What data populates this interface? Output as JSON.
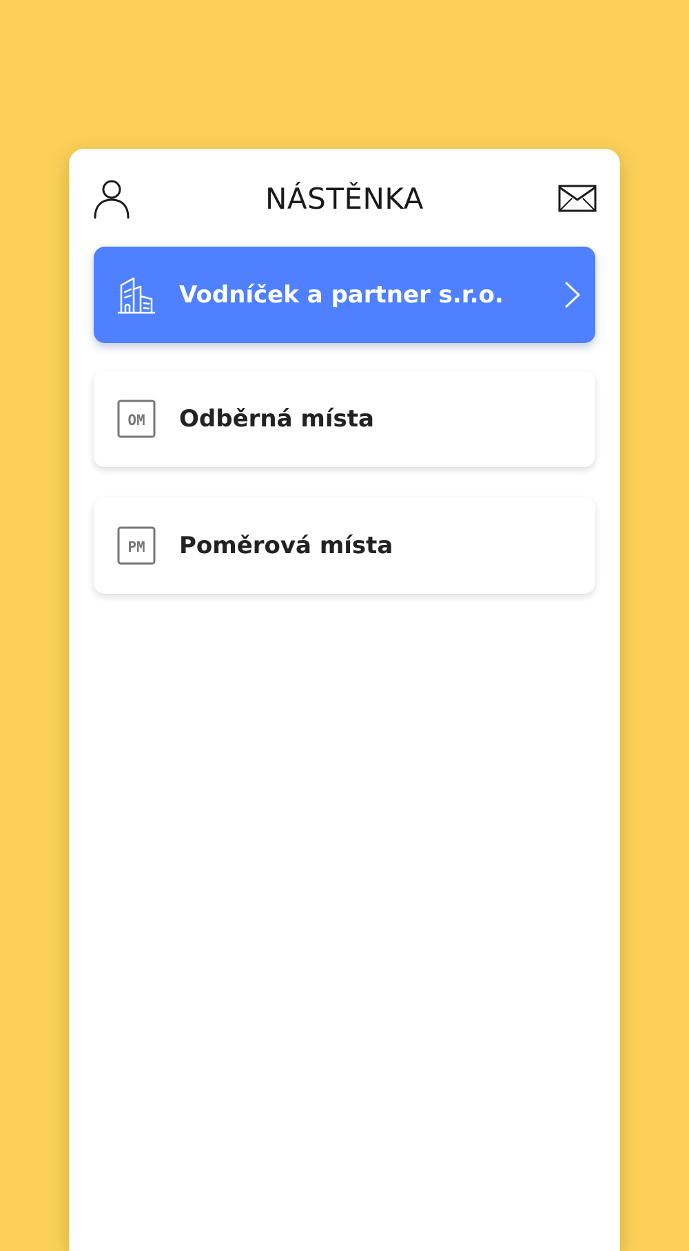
{
  "header": {
    "title": "NÁSTĚNKA",
    "profile_icon": "user-profile-icon",
    "mail_icon": "mail-envelope-icon"
  },
  "menu": {
    "items": [
      {
        "label": "Vodníček a partner s.r.o.",
        "icon": "building-icon",
        "chevron_icon": "chevron-right-icon",
        "highlighted": true
      },
      {
        "label": "Odběrná místa",
        "icon": "om-badge-icon",
        "badge": "OM"
      },
      {
        "label": "Poměrová místa",
        "icon": "pm-badge-icon",
        "badge": "PM"
      }
    ]
  },
  "colors": {
    "background": "#FBD15A",
    "accent": "#4F80FF",
    "card": "#FFFFFF",
    "text": "#222222",
    "icon_gray": "#777777"
  }
}
